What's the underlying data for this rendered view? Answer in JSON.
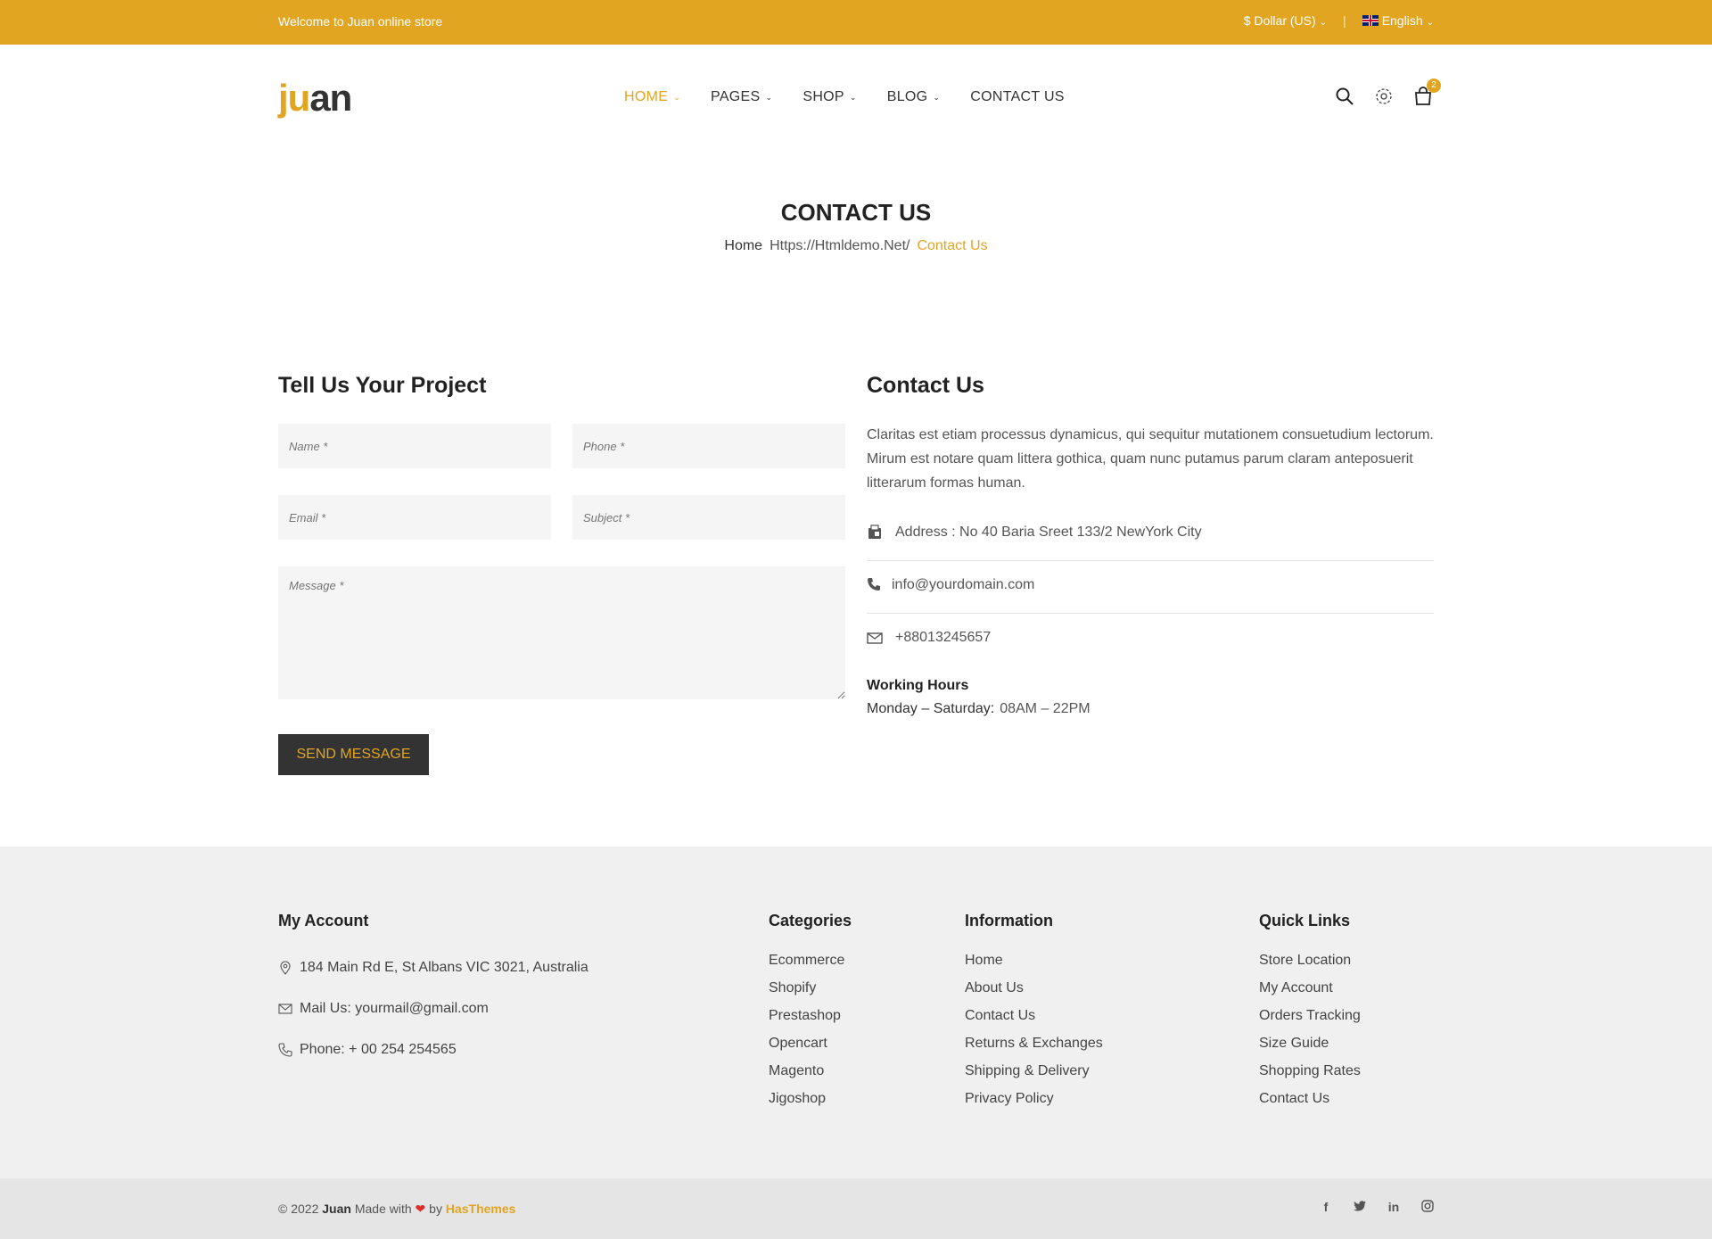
{
  "topbar": {
    "welcome": "Welcome to Juan online store",
    "currency": "$ Dollar (US)",
    "language": "English",
    "color": "#e1a522"
  },
  "header": {
    "logo_accent": "ju",
    "logo_rest": "an",
    "nav": [
      {
        "label": "HOME",
        "dropdown": true,
        "active": true
      },
      {
        "label": "PAGES",
        "dropdown": true
      },
      {
        "label": "SHOP",
        "dropdown": true
      },
      {
        "label": "BLOG",
        "dropdown": true
      },
      {
        "label": "CONTACT US",
        "dropdown": false
      }
    ],
    "icons": [
      "search-icon",
      "settings-icon",
      "cart-icon"
    ],
    "cart_count": "2"
  },
  "page": {
    "title": "CONTACT US",
    "breadcrumb": {
      "home": "Home",
      "sep": "Https://Htmldemo.Net/",
      "current": "Contact Us"
    }
  },
  "form": {
    "title": "Tell Us Your Project",
    "name_placeholder": "Name *",
    "phone_placeholder": "Phone *",
    "email_placeholder": "Email *",
    "subject_placeholder": "Subject *",
    "message_placeholder": "Message *",
    "send_label": "SEND MESSAGE"
  },
  "contact": {
    "title": "Contact Us",
    "description": "Claritas est etiam processus dynamicus, qui sequitur mutationem consuetudium lectorum. Mirum est notare quam littera gothica, quam nunc putamus parum claram anteposuerit litterarum formas human.",
    "address": "Address : No 40 Baria Sreet 133/2 NewYork City",
    "email": "info@yourdomain.com",
    "phone": "+88013245657",
    "hours_title": "Working Hours",
    "hours_days": "Monday – Saturday:",
    "hours_time": "08AM – 22PM"
  },
  "footer": {
    "account": {
      "title": "My Account",
      "address": "184 Main Rd E, St Albans VIC 3021, Australia",
      "mail": "Mail Us: yourmail@gmail.com",
      "phone": "Phone: + 00 254 254565"
    },
    "categories": {
      "title": "Categories",
      "links": [
        "Ecommerce",
        "Shopify",
        "Prestashop",
        "Opencart",
        "Magento",
        "Jigoshop"
      ]
    },
    "information": {
      "title": "Information",
      "links": [
        "Home",
        "About Us",
        "Contact Us",
        "Returns & Exchanges",
        "Shipping & Delivery",
        "Privacy Policy"
      ]
    },
    "quick": {
      "title": "Quick Links",
      "links": [
        "Store Location",
        "My Account",
        "Orders Tracking",
        "Size Guide",
        "Shopping Rates",
        "Contact Us"
      ]
    },
    "copyright": {
      "prefix": "© 2022",
      "brand": "Juan",
      "made": "Made with",
      "by": "by",
      "author": "HasThemes"
    },
    "social": [
      "f",
      "t",
      "in",
      "ig"
    ]
  }
}
